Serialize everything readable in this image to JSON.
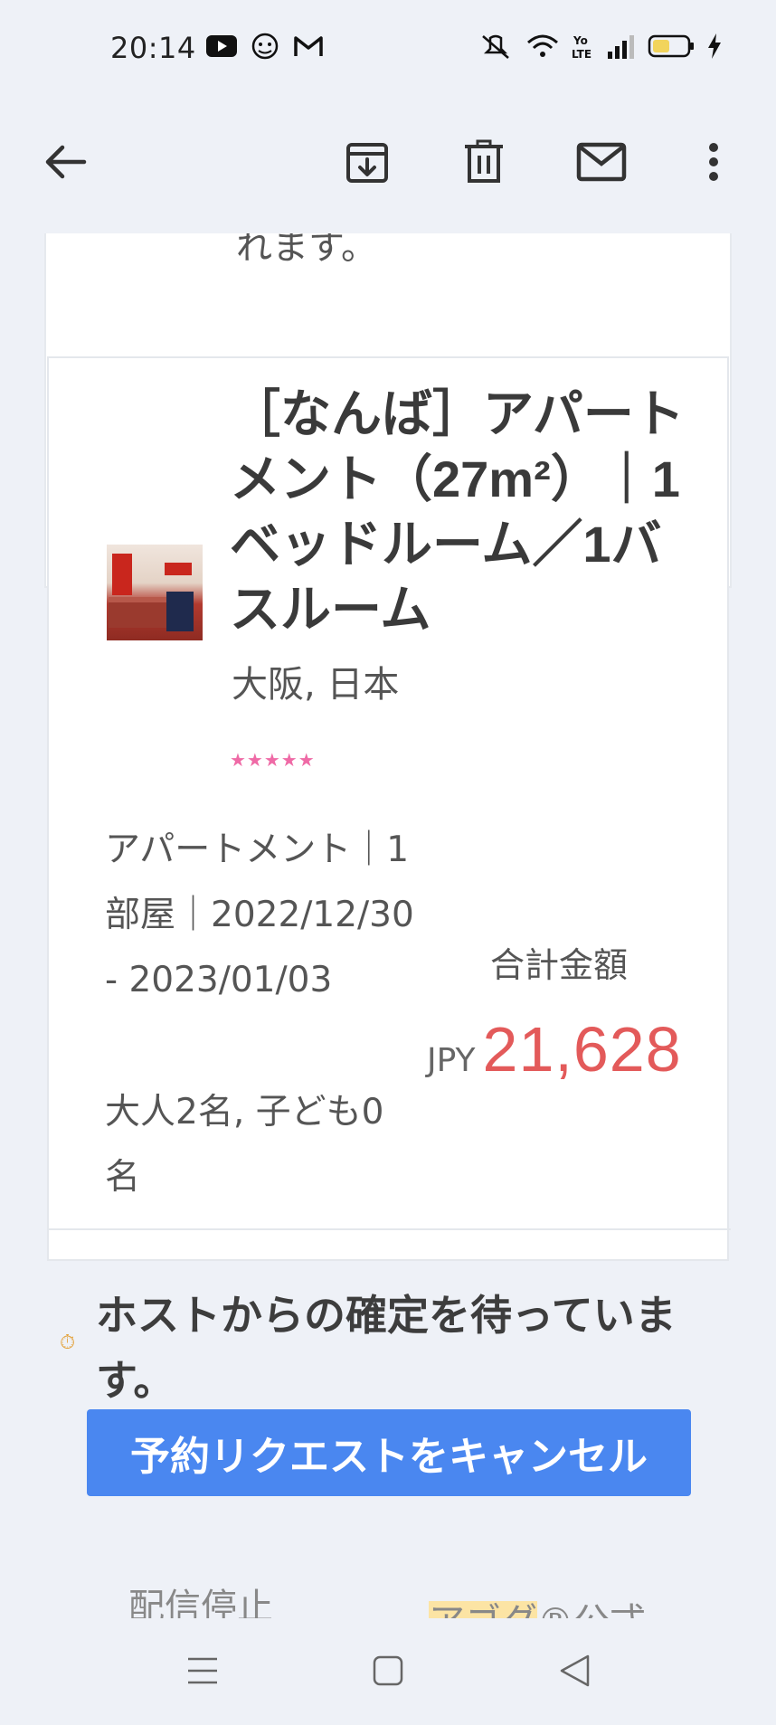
{
  "status_bar": {
    "time": "20:14",
    "left_icons": [
      "youtube-icon",
      "app-icon",
      "gmail-icon"
    ],
    "right_icons": [
      "mute-icon",
      "wifi-icon",
      "volte-icon",
      "signal-icon",
      "battery-icon",
      "charging-icon"
    ]
  },
  "app_bar": {
    "icons": [
      "back-arrow-icon",
      "archive-icon",
      "delete-icon",
      "mail-icon",
      "more-icon"
    ]
  },
  "email": {
    "prev_text_fragment": "れます。",
    "listing": {
      "title": "［なんば］アパートメント（27m²）｜1ベッドルーム／1バスルーム",
      "location": "大阪, 日本",
      "rating_stars": "★★★★★",
      "rating_value": 5,
      "details": "アパートメント｜1部屋｜2022/12/30 - 2023/01/03",
      "guests": "大人2名, 子ども0名",
      "total_label": "合計金額",
      "currency": "JPY",
      "amount": "21,628"
    },
    "pending_status": "ホストからの確定を待っています。",
    "cancel_button": "予約リクエストをキャンセル",
    "footer": {
      "unsubscribe": "配信停止",
      "brand_highlight": "アゴダ",
      "brand_suffix": "®公式"
    }
  },
  "colors": {
    "background": "#eef1f7",
    "price": "#e35a5a",
    "button": "#4a87f0",
    "stars": "#ef6aa6",
    "highlight": "#fce4a4"
  },
  "nav_bar": {
    "icons": [
      "menu-icon",
      "home-square-icon",
      "back-triangle-icon"
    ]
  }
}
